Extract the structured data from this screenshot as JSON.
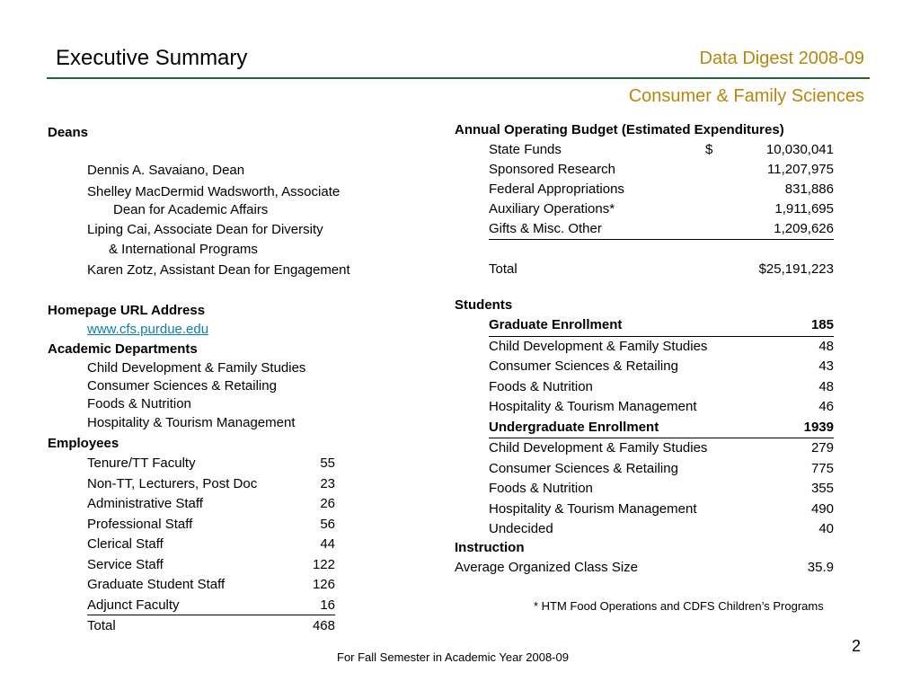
{
  "header": {
    "title": "Executive Summary",
    "digest": "Data Digest 2008-09",
    "department": "Consumer & Family Sciences",
    "accent_color": "#b8860b",
    "rule_color": "#1f6b2a"
  },
  "deans": {
    "heading": "Deans",
    "lines": [
      "Dennis A. Savaiano, Dean",
      "Shelley MacDermid Wadsworth,  Associate",
      "Dean for Academic  Affairs",
      "Liping Cai, Associate Dean for Diversity",
      "& International Programs",
      "Karen Zotz, Assistant Dean for Engagement"
    ]
  },
  "homepage": {
    "heading": "Homepage URL Address",
    "url": "www.cfs.purdue.edu"
  },
  "academic_departments": {
    "heading": "Academic Departments",
    "items": [
      "Child Development & Family Studies",
      "Consumer Sciences & Retailing",
      "Foods & Nutrition",
      "Hospitality & Tourism Management"
    ]
  },
  "employees": {
    "heading": "Employees",
    "rows": [
      {
        "label": "Tenure/TT Faculty",
        "value": "55"
      },
      {
        "label": "Non-TT, Lecturers, Post Doc",
        "value": "23"
      },
      {
        "label": "Administrative Staff",
        "value": "26"
      },
      {
        "label": "Professional Staff",
        "value": "56"
      },
      {
        "label": "Clerical Staff",
        "value": "44"
      },
      {
        "label": "Service Staff",
        "value": "122"
      },
      {
        "label": "Graduate Student Staff",
        "value": "126"
      },
      {
        "label": "Adjunct Faculty",
        "value": "16"
      },
      {
        "label": "Total",
        "value": "468"
      }
    ]
  },
  "budget": {
    "heading": "Annual Operating Budget (Estimated Expenditures)",
    "dollar_sign": "$",
    "rows": [
      {
        "label": "State Funds",
        "value": "10,030,041"
      },
      {
        "label": "Sponsored Research",
        "value": "11,207,975"
      },
      {
        "label": "Federal Appropriations",
        "value": "831,886"
      },
      {
        "label": "Auxiliary Operations*",
        "value": "1,911,695"
      },
      {
        "label": "Gifts & Misc. Other",
        "value": "1,209,626"
      }
    ],
    "total_label": "Total",
    "total_value": "$25,191,223"
  },
  "students": {
    "heading": "Students",
    "graduate": {
      "label": "Graduate Enrollment",
      "value": "185",
      "rows": [
        {
          "label": "Child Development & Family Studies",
          "value": "48"
        },
        {
          "label": "Consumer Sciences & Retailing",
          "value": "43"
        },
        {
          "label": "Foods & Nutrition",
          "value": "48"
        },
        {
          "label": "Hospitality & Tourism Management",
          "value": "46"
        }
      ]
    },
    "undergraduate": {
      "label": "Undergraduate Enrollment",
      "value": "1939",
      "rows": [
        {
          "label": "Child Development & Family Studies",
          "value": "279"
        },
        {
          "label": "Consumer Sciences & Retailing",
          "value": "775"
        },
        {
          "label": "Foods & Nutrition",
          "value": "355"
        },
        {
          "label": "Hospitality & Tourism Management",
          "value": "490"
        },
        {
          "label": "Undecided",
          "value": "40"
        }
      ]
    }
  },
  "instruction": {
    "heading": "Instruction",
    "label": "Average Organized Class Size",
    "value": "35.9"
  },
  "footnote": "* HTM Food Operations and CDFS Children’s Programs",
  "page_number": "2",
  "footer": "For Fall Semester in Academic Year 2008-09"
}
